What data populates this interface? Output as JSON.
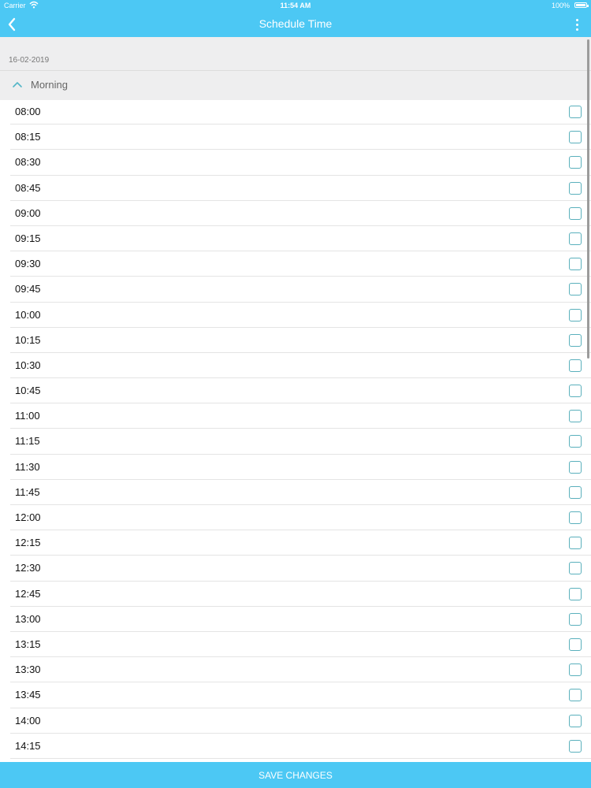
{
  "status_bar": {
    "carrier": "Carrier",
    "time": "11:54 AM",
    "battery": "100%"
  },
  "header": {
    "title": "Schedule Time",
    "accent_color": "#4cc8f4"
  },
  "schedule": {
    "date": "16-02-2019",
    "section": {
      "label": "Morning",
      "expanded": true
    },
    "slots": [
      {
        "time": "08:00",
        "checked": false
      },
      {
        "time": "08:15",
        "checked": false
      },
      {
        "time": "08:30",
        "checked": false
      },
      {
        "time": "08:45",
        "checked": false
      },
      {
        "time": "09:00",
        "checked": false
      },
      {
        "time": "09:15",
        "checked": false
      },
      {
        "time": "09:30",
        "checked": false
      },
      {
        "time": "09:45",
        "checked": false
      },
      {
        "time": "10:00",
        "checked": false
      },
      {
        "time": "10:15",
        "checked": false
      },
      {
        "time": "10:30",
        "checked": false
      },
      {
        "time": "10:45",
        "checked": false
      },
      {
        "time": "11:00",
        "checked": false
      },
      {
        "time": "11:15",
        "checked": false
      },
      {
        "time": "11:30",
        "checked": false
      },
      {
        "time": "11:45",
        "checked": false
      },
      {
        "time": "12:00",
        "checked": false
      },
      {
        "time": "12:15",
        "checked": false
      },
      {
        "time": "12:30",
        "checked": false
      },
      {
        "time": "12:45",
        "checked": false
      },
      {
        "time": "13:00",
        "checked": false
      },
      {
        "time": "13:15",
        "checked": false
      },
      {
        "time": "13:30",
        "checked": false
      },
      {
        "time": "13:45",
        "checked": false
      },
      {
        "time": "14:00",
        "checked": false
      },
      {
        "time": "14:15",
        "checked": false
      }
    ]
  },
  "footer": {
    "save_label": "SAVE CHANGES"
  },
  "icons": {
    "back": "chevron-left-icon",
    "more": "more-vertical-icon",
    "section_toggle": "chevron-up-icon",
    "wifi": "wifi-icon",
    "battery": "battery-icon",
    "slot_checkbox": "checkbox-icon"
  }
}
